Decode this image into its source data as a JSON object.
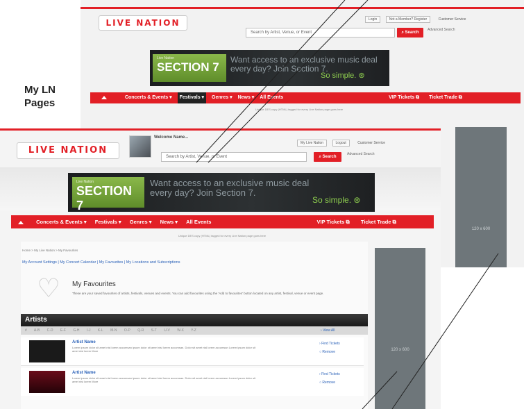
{
  "side_label": "My LN Pages",
  "logo_text": "LIVE NATION",
  "back": {
    "toplinks": [
      "Login",
      "Not a Member? Register",
      "Customer Service"
    ],
    "search_placeholder": "Search by Artist, Venue, or Event",
    "search_button": "Search",
    "advanced": "Advanced Search",
    "banner": {
      "section_tag": "Live Nation",
      "section_title": "SECTION 7",
      "message": "Want access to an exclusive music deal every day? Join Section 7.",
      "simple": "So simple."
    },
    "nav": [
      "Concerts & Events",
      "Festivals",
      "Genres",
      "News",
      "All Events",
      "VIP Tickets",
      "Ticket Trade"
    ],
    "subline": "Unique DES copy (HTML) tagged for every Live Nation page goes here"
  },
  "front": {
    "welcome": "Welcome Name",
    "toplinks": [
      "My Live Nation",
      "Logout",
      "Customer Service"
    ],
    "search_placeholder": "Search by Artist, Venue, or Event",
    "search_button": "Search",
    "advanced": "Advanced Search",
    "banner": {
      "section_tag": "Live Nation",
      "section_title": "SECTION 7",
      "message": "Want access to an exclusive music deal every day? Join Section 7.",
      "simple": "So simple."
    },
    "nav": [
      "Concerts & Events",
      "Festivals",
      "Genres",
      "News",
      "All Events",
      "VIP Tickets",
      "Ticket Trade"
    ],
    "subline": "Unique DES copy (HTML) tagged for every Live Nation page goes here",
    "breadcrumb": "Home > My Live Nation > My Favourites",
    "account_links": "My Account Settings | My Concert Calendar | My Favourites | My Locations and Subscriptions",
    "favourites_title": "My Favourites",
    "favourites_desc": "These are your saved favourites of artists, festivals, venues and events. You can add favourites using the 'Add to favourites' button located on any artist, festival, venue or event page.",
    "artists_header": "Artists",
    "alphabet": [
      "#",
      "A-B",
      "C-D",
      "E-F",
      "G-H",
      "I-J",
      "K-L",
      "M-N",
      "O-P",
      "Q-R",
      "S-T",
      "U-V",
      "W-X",
      "Y-Z"
    ],
    "view_all": "View All",
    "artists": [
      {
        "name": "Artist Name",
        "desc": "Lorem ipsum dolor sit amet nisl lorem accumsan ipsum dolor sit amet nisl lorem accumsan. Dolor sit amet nisl lorem accumsan Lorem ipsum dolor sit amet nisl lorem More",
        "find": "Find Tickets",
        "remove": "Remove"
      },
      {
        "name": "Artist Name",
        "desc": "Lorem ipsum dolor sit amet nisl lorem accumsan ipsum dolor sit amet nisl lorem accumsan. Dolor sit amet nisl lorem accumsan Lorem ipsum dolor sit amet nisl lorem More",
        "find": "Find Tickets",
        "remove": "Remove"
      }
    ]
  },
  "ads": {
    "back": "120 x 600",
    "front": "120 x 600"
  }
}
